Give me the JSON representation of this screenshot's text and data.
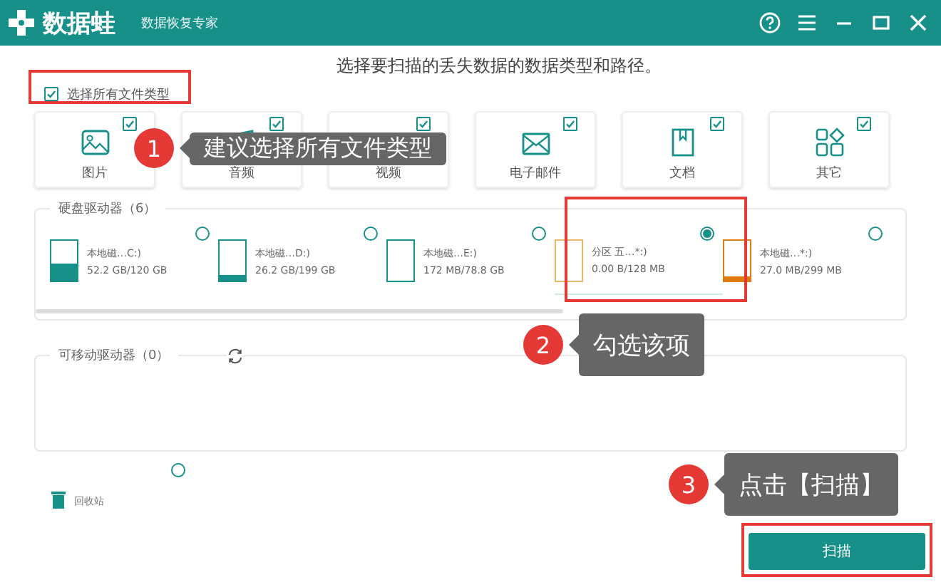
{
  "window": {
    "app_name": "数据蛙",
    "subtitle": "数据恢复专家"
  },
  "heading": "选择要扫描的丢失数据的数据类型和路径。",
  "select_all": {
    "label": "选择所有文件类型",
    "checked": true
  },
  "file_types": [
    {
      "kind": "image",
      "label": "图片",
      "checked": true
    },
    {
      "kind": "audio",
      "label": "音频",
      "checked": true
    },
    {
      "kind": "video",
      "label": "视频",
      "checked": true
    },
    {
      "kind": "email",
      "label": "电子邮件",
      "checked": true
    },
    {
      "kind": "document",
      "label": "文档",
      "checked": true
    },
    {
      "kind": "other",
      "label": "其它",
      "checked": true
    }
  ],
  "hard_drives": {
    "title": "硬盘驱动器（6）",
    "drives": [
      {
        "name": "本地磁…C:)",
        "size": "52.2 GB/120 GB",
        "level": 0.43,
        "color": "#17908a",
        "selected": false
      },
      {
        "name": "本地磁…D:)",
        "size": "26.2 GB/199 GB",
        "level": 0.13,
        "color": "#17908a",
        "selected": false
      },
      {
        "name": "本地磁…E:)",
        "size": "172 MB/78.8 GB",
        "level": 0,
        "color": "#17908a",
        "selected": false
      },
      {
        "name": "分区 五…*:)",
        "size": "0.00  B/128 MB",
        "level": 0,
        "color": "#e8b86a",
        "selected": true
      },
      {
        "name": "本地磁…*:)",
        "size": "27.0 MB/299 MB",
        "level": 0.09,
        "color": "#e07b10",
        "selected": false
      }
    ]
  },
  "removable_drives": {
    "title": "可移动驱动器（0）"
  },
  "recycle_bin": {
    "label": "回收站",
    "selected": false
  },
  "scan_button": "扫描",
  "callouts": [
    {
      "number": "1",
      "text": "建议选择所有文件类型"
    },
    {
      "number": "2",
      "text": "勾选该项"
    },
    {
      "number": "3",
      "text": "点击【扫描】"
    }
  ]
}
